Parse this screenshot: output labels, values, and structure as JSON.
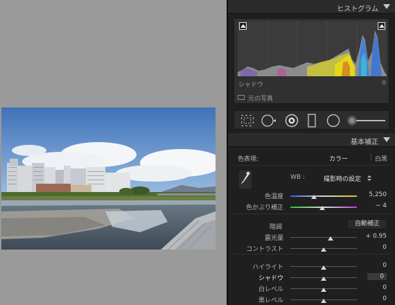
{
  "histogram": {
    "title": "ヒストグラム",
    "label": "シャドウ",
    "value": "0",
    "original_photo_label": "元の写真"
  },
  "basic": {
    "title": "基本補正",
    "color_treatment_label": "色表現:",
    "color_option": "カラー",
    "bw_option": "白黒",
    "wb_label": "WB :",
    "wb_value": "撮影時の設定",
    "tone_label": "階調",
    "auto_button": "自動補正",
    "sliders": [
      {
        "label": "色温度",
        "value": "5,250",
        "pos": 0.35
      },
      {
        "label": "色かぶり補正",
        "value": "− 4",
        "pos": 0.48
      },
      {
        "label": "露光量",
        "value": "+ 0.95",
        "pos": 0.6
      },
      {
        "label": "コントラスト",
        "value": "0",
        "pos": 0.5
      },
      {
        "label": "ハイライト",
        "value": "0",
        "pos": 0.5
      },
      {
        "label": "シャドウ",
        "value": "0",
        "pos": 0.5
      },
      {
        "label": "白レベル",
        "value": "0",
        "pos": 0.5
      },
      {
        "label": "黒レベル",
        "value": "0",
        "pos": 0.5
      }
    ]
  },
  "tool_icons": [
    "crop-icon",
    "spot-removal-icon",
    "red-eye-icon",
    "graduated-filter-icon",
    "radial-filter-icon",
    "adjustment-brush-icon"
  ]
}
